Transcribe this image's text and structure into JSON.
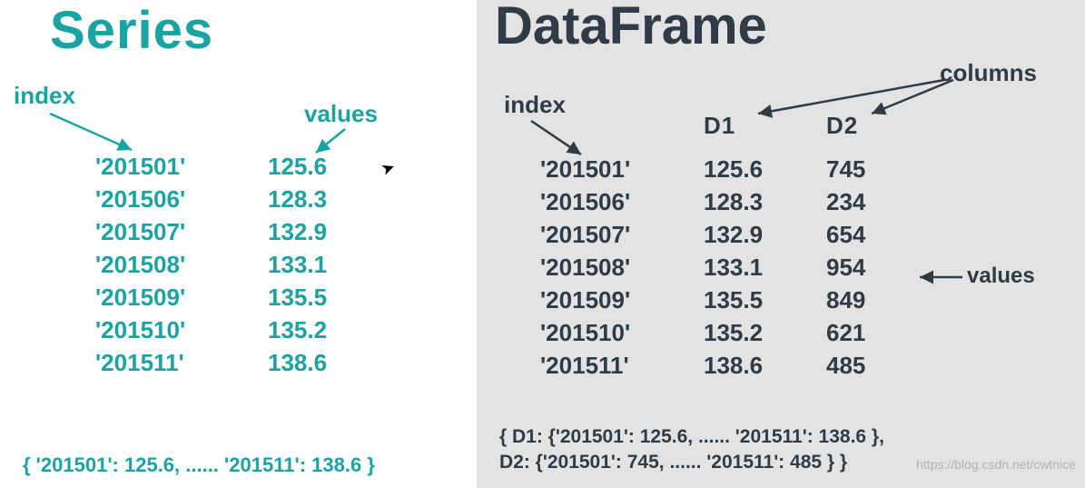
{
  "series": {
    "title": "Series",
    "labels": {
      "index": "index",
      "values": "values"
    },
    "rows": [
      {
        "idx": "'201501'",
        "val": "125.6"
      },
      {
        "idx": "'201506'",
        "val": "128.3"
      },
      {
        "idx": "'201507'",
        "val": "132.9"
      },
      {
        "idx": "'201508'",
        "val": "133.1"
      },
      {
        "idx": "'201509'",
        "val": "135.5"
      },
      {
        "idx": "'201510'",
        "val": "135.2"
      },
      {
        "idx": "'201511'",
        "val": "138.6"
      }
    ],
    "dict": "{ '201501': 125.6,   ......   '201511':    138.6 }"
  },
  "dataframe": {
    "title": "DataFrame",
    "labels": {
      "index": "index",
      "columns": "columns",
      "values": "values"
    },
    "headers": {
      "d1": "D1",
      "d2": "D2"
    },
    "rows": [
      {
        "idx": "'201501'",
        "d1": "125.6",
        "d2": "745"
      },
      {
        "idx": "'201506'",
        "d1": "128.3",
        "d2": "234"
      },
      {
        "idx": "'201507'",
        "d1": "132.9",
        "d2": "654"
      },
      {
        "idx": "'201508'",
        "d1": "133.1",
        "d2": "954"
      },
      {
        "idx": "'201509'",
        "d1": "135.5",
        "d2": "849"
      },
      {
        "idx": "'201510'",
        "d1": "135.2",
        "d2": "621"
      },
      {
        "idx": "'201511'",
        "d1": "138.6",
        "d2": "485"
      }
    ],
    "dict_line1": "{  D1: {'201501': 125.6,   ......   '201511':    138.6 },",
    "dict_line2": "   D2: {'201501': 745,      ......   '201511':    485  }  }"
  },
  "watermark": "https://blog.csdn.net/cwtnice"
}
